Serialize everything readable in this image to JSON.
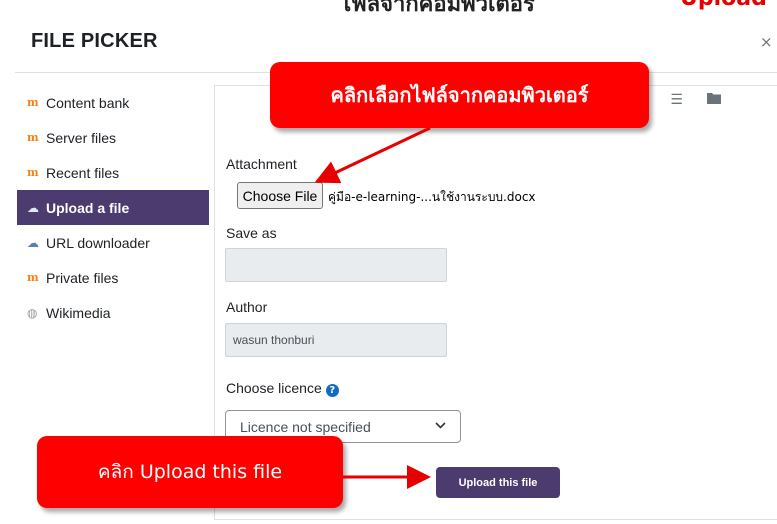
{
  "top_strip": {
    "partial_text_left": "ไฟล์จากคอมพิวเตอร์",
    "partial_text_right": "Upload"
  },
  "dialog": {
    "title": "FILE PICKER",
    "close_symbol": "×"
  },
  "sidebar": {
    "items": [
      {
        "label": "Content bank",
        "icon": "moodle-icon",
        "glyph": "m"
      },
      {
        "label": "Server files",
        "icon": "moodle-icon",
        "glyph": "m"
      },
      {
        "label": "Recent files",
        "icon": "moodle-icon",
        "glyph": "m"
      },
      {
        "label": "Upload a file",
        "icon": "upload-cloud-icon",
        "glyph": "☁",
        "active": true
      },
      {
        "label": "URL downloader",
        "icon": "url-cloud-icon",
        "glyph": "☁"
      },
      {
        "label": "Private files",
        "icon": "moodle-icon",
        "glyph": "m"
      },
      {
        "label": "Wikimedia",
        "icon": "wikimedia-globe-icon",
        "glyph": "◍"
      }
    ]
  },
  "view_icons": [
    "grid-view-icon",
    "list-view-icon",
    "folder-view-icon"
  ],
  "form": {
    "attachment_label": "Attachment",
    "choose_file_label": "Choose File",
    "chosen_file_name": "คู่มือ-e-learning-...นใช้งานระบบ.docx",
    "save_as_label": "Save as",
    "save_as_value": "",
    "author_label": "Author",
    "author_value": "wasun thonburi",
    "licence_label": "Choose licence",
    "licence_selected": "Licence not specified",
    "upload_button_label": "Upload this file"
  },
  "annotations": {
    "callout_choose": "คลิกเลือกไฟล์จากคอมพิวเตอร์",
    "callout_upload": "คลิก Upload this file",
    "callout_color": "#ff0000"
  },
  "colors": {
    "accent": "#4c3b6f",
    "moodle_orange": "#f98012",
    "help_blue": "#0f6cbf"
  }
}
